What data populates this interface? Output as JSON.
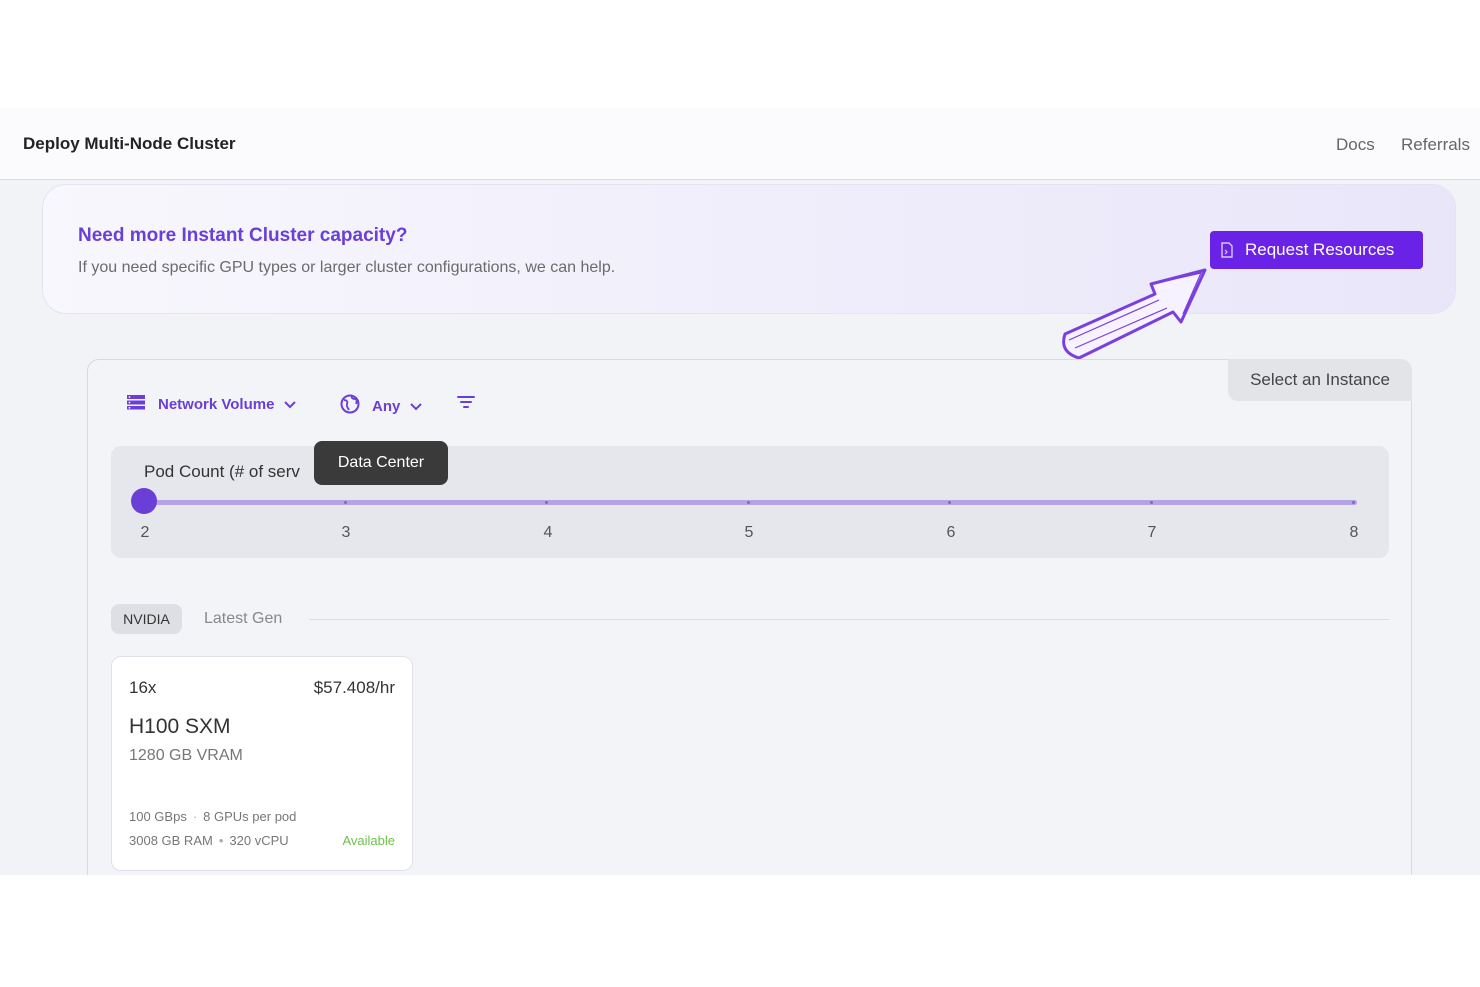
{
  "header": {
    "title": "Deploy Multi-Node Cluster",
    "nav": {
      "docs": "Docs",
      "referrals": "Referrals"
    }
  },
  "banner": {
    "title": "Need more Instant Cluster capacity?",
    "description": "If you need specific GPU types or larger cluster configurations, we can help.",
    "button_label": "Request Resources",
    "button_icon": "document-icon",
    "accent_color": "#6a22e6"
  },
  "panel": {
    "tab_label": "Select an Instance",
    "filters": {
      "storage": {
        "label": "Network Volume",
        "icon": "server-stack-icon"
      },
      "region": {
        "label": "Any",
        "icon": "globe-icon"
      },
      "sort_icon": "filter-lines-icon"
    },
    "tooltip": "Data Center",
    "pod_count": {
      "label": "Pod Count (# of serv",
      "value": 2,
      "min": 2,
      "max": 8,
      "ticks": [
        "2",
        "3",
        "4",
        "5",
        "6",
        "7",
        "8"
      ]
    },
    "vendor_tabs": {
      "active": "NVIDIA",
      "other": "Latest Gen"
    },
    "gpu_card": {
      "count": "16x",
      "price": "$57.408/hr",
      "name": "H100 SXM",
      "vram": "1280 GB VRAM",
      "spec_bandwidth": "100 GBps",
      "spec_gpus": "8 GPUs per pod",
      "spec_ram": "3008 GB RAM",
      "spec_vcpu": "320 vCPU",
      "status": "Available",
      "status_color": "#6cc24a"
    }
  }
}
